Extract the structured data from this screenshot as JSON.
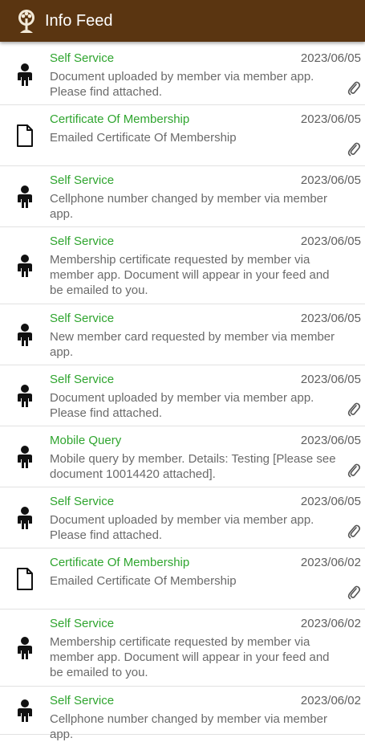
{
  "header": {
    "title": "Info Feed",
    "logo_icon": "tree-logo-icon"
  },
  "colors": {
    "header_bg": "#5a3511",
    "title_green": "#2fa52f",
    "text_gray": "#6a6a6a"
  },
  "feed": [
    {
      "title": "Self Service",
      "date": "2023/06/05",
      "icon": "person-icon",
      "description": "Document uploaded by member via member app. Please find attached.",
      "attachment": true
    },
    {
      "title": "Certificate Of Membership",
      "date": "2023/06/05",
      "icon": "document-icon",
      "description": "Emailed Certificate Of Membership",
      "attachment": true
    },
    {
      "title": "Self Service",
      "date": "2023/06/05",
      "icon": "person-icon",
      "description": "Cellphone number changed by member via member app.",
      "attachment": false
    },
    {
      "title": "Self Service",
      "date": "2023/06/05",
      "icon": "person-icon",
      "description": "Membership certificate requested by member via member app. Document will appear in your feed and be emailed to you.",
      "attachment": false
    },
    {
      "title": "Self Service",
      "date": "2023/06/05",
      "icon": "person-icon",
      "description": "New member card requested by member via member app.",
      "attachment": false
    },
    {
      "title": "Self Service",
      "date": "2023/06/05",
      "icon": "person-icon",
      "description": "Document uploaded by member via member app. Please find attached.",
      "attachment": true
    },
    {
      "title": "Mobile Query",
      "date": "2023/06/05",
      "icon": "person-icon",
      "description": "Mobile query by member.  Details: Testing [Please see document 10014420 attached].",
      "attachment": true
    },
    {
      "title": "Self Service",
      "date": "2023/06/05",
      "icon": "person-icon",
      "description": "Document uploaded by member via member app. Please find attached.",
      "attachment": true
    },
    {
      "title": "Certificate Of Membership",
      "date": "2023/06/02",
      "icon": "document-icon",
      "description": "Emailed Certificate Of Membership",
      "attachment": true
    },
    {
      "title": "Self Service",
      "date": "2023/06/02",
      "icon": "person-icon",
      "description": "Membership certificate requested by member via member app. Document will appear in your feed and be emailed to you.",
      "attachment": false
    },
    {
      "title": "Self Service",
      "date": "2023/06/02",
      "icon": "person-icon",
      "description": "Cellphone number changed by member via member app.",
      "attachment": false
    }
  ]
}
